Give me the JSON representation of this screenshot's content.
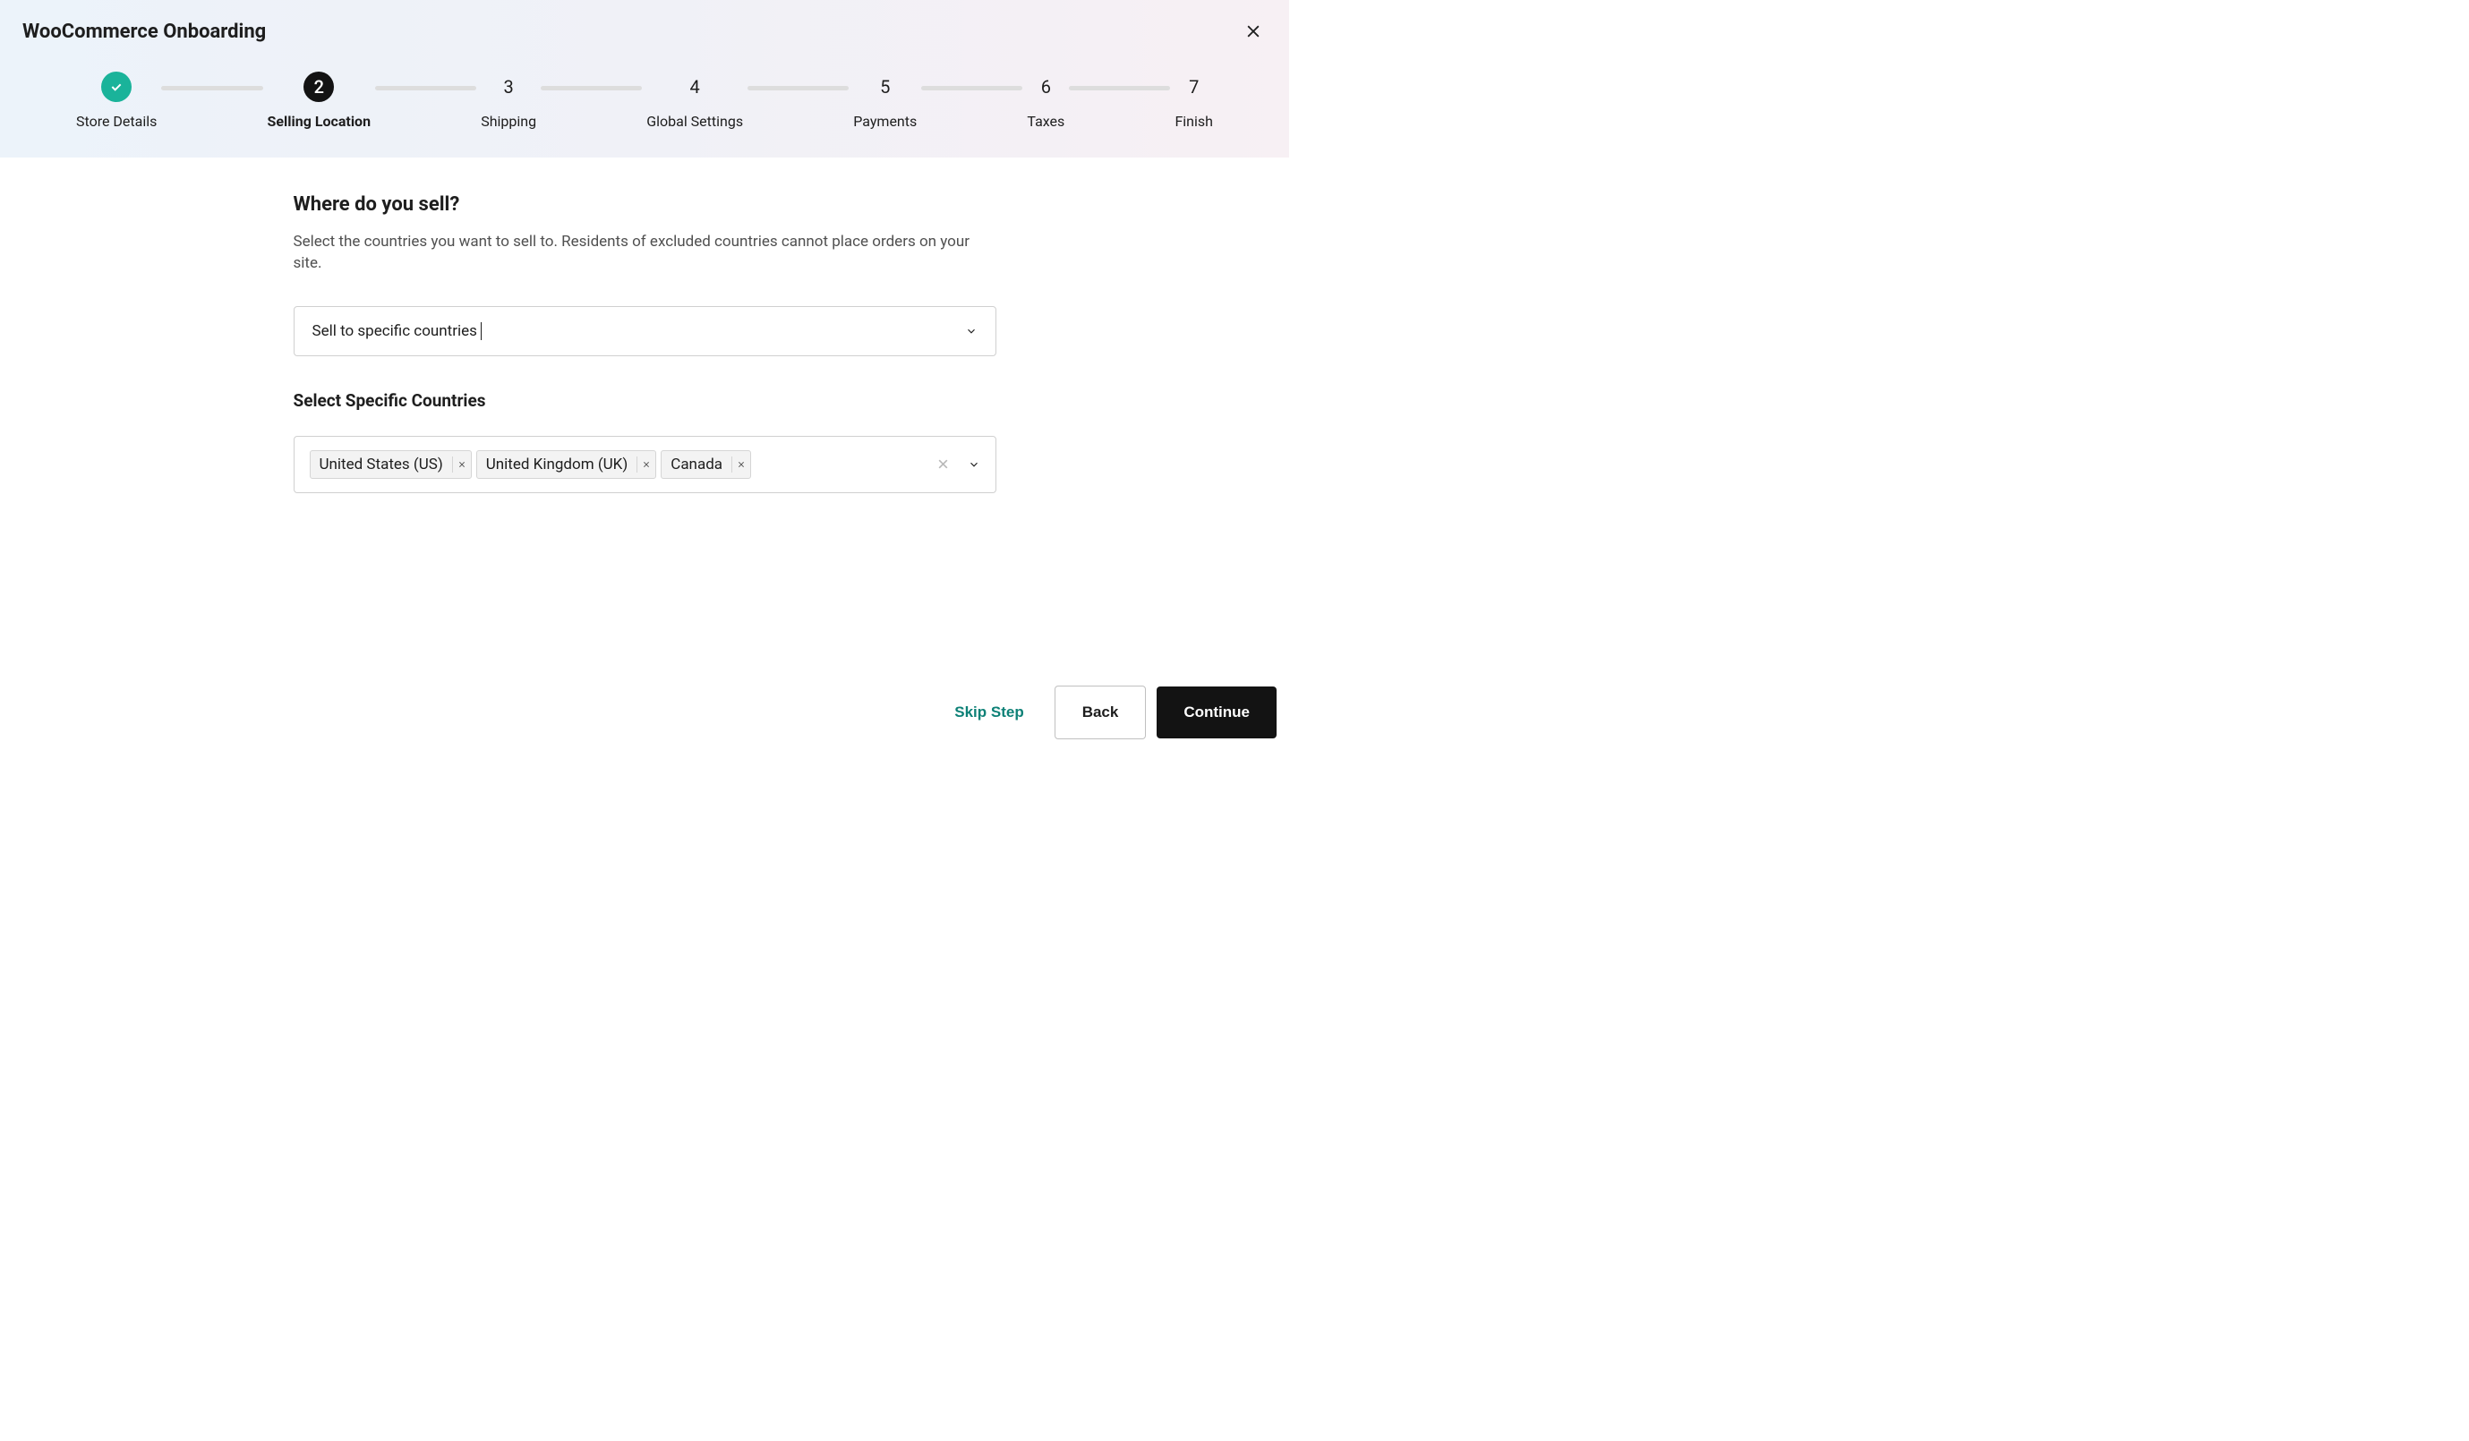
{
  "header": {
    "title": "WooCommerce Onboarding"
  },
  "stepper": {
    "steps": [
      {
        "label": "Store Details",
        "state": "completed"
      },
      {
        "label": "Selling Location",
        "state": "active",
        "num": "2"
      },
      {
        "label": "Shipping",
        "state": "pending",
        "num": "3"
      },
      {
        "label": "Global Settings",
        "state": "pending",
        "num": "4"
      },
      {
        "label": "Payments",
        "state": "pending",
        "num": "5"
      },
      {
        "label": "Taxes",
        "state": "pending",
        "num": "6"
      },
      {
        "label": "Finish",
        "state": "pending",
        "num": "7"
      }
    ]
  },
  "main": {
    "question_title": "Where do you sell?",
    "question_desc": "Select the countries you want to sell to. Residents of excluded countries cannot place orders on your site.",
    "select_value": "Sell to specific countries",
    "countries_label": "Select Specific Countries",
    "selected_countries": [
      "United States (US)",
      "United Kingdom (UK)",
      "Canada"
    ]
  },
  "footer": {
    "skip_label": "Skip Step",
    "back_label": "Back",
    "continue_label": "Continue"
  }
}
